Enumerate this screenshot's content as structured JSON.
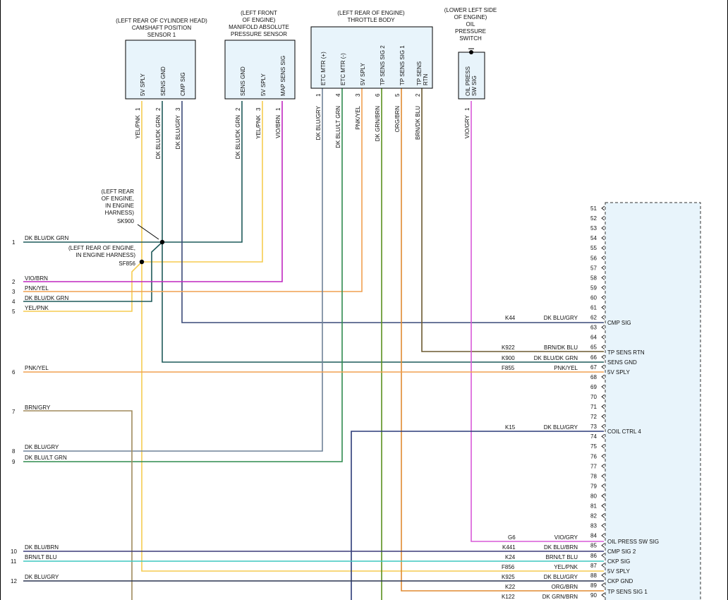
{
  "components": {
    "cmp_sensor": {
      "heading": [
        "(LEFT REAR OF CYLINDER HEAD)",
        "CAMSHAFT POSITION",
        "SENSOR 1"
      ],
      "pins": [
        {
          "num": "1",
          "name": "5V SPLY",
          "wire": "YEL/PNK"
        },
        {
          "num": "2",
          "name": "SENS GND",
          "wire": "DK BLU/DK GRN"
        },
        {
          "num": "3",
          "name": "CMP SIG",
          "wire": "DK BLU/GRY"
        }
      ]
    },
    "map_sensor": {
      "heading": [
        "(LEFT FRONT",
        "OF ENGINE)",
        "MANIFOLD ABSOLUTE",
        "PRESSURE SENSOR"
      ],
      "pins": [
        {
          "num": "2",
          "name": "SENS GND",
          "wire": "DK BLU/DK GRN"
        },
        {
          "num": "3",
          "name": "5V SPLY",
          "wire": "YEL/PNK"
        },
        {
          "num": "1",
          "name": "MAP SENS SIG",
          "wire": "VIO/BRN"
        }
      ]
    },
    "throttle_body": {
      "heading": [
        "(LEFT REAR OF ENGINE)",
        "THROTTLE BODY"
      ],
      "pins": [
        {
          "num": "1",
          "name": "ETC MTR (+)",
          "wire": "DK BLU/GRY"
        },
        {
          "num": "4",
          "name": "ETC MTR (-)",
          "wire": "DK BLU/LT GRN"
        },
        {
          "num": "3",
          "name": "5V SPLY",
          "wire": "PNK/YEL"
        },
        {
          "num": "6",
          "name": "TP SENS SIG 2",
          "wire": "DK GRN/BRN"
        },
        {
          "num": "5",
          "name": "TP SENS SIG 1",
          "wire": "ORG/BRN"
        },
        {
          "num": "2",
          "name": "TP SENS RTN",
          "wire": "BRN/DK BLU"
        }
      ]
    },
    "oil_switch": {
      "heading": [
        "(LOWER LEFT SIDE",
        "OF ENGINE)",
        "OIL",
        "PRESSURE",
        "SWITCH"
      ],
      "pins": [
        {
          "num": "1",
          "name": "OIL PRESS SW SIG",
          "wire": "VIO/GRY"
        }
      ]
    }
  },
  "splices": {
    "sk900": [
      "(LEFT REAR",
      "OF ENGINE,",
      "IN ENGINE",
      "HARNESS)",
      "SK900"
    ],
    "sf856": [
      "(LEFT REAR OF ENGINE,",
      "IN ENGINE HARNESS)",
      "SF856"
    ]
  },
  "left_wires": [
    {
      "num": "1",
      "label": "DK BLU/DK GRN",
      "color": "#1f5a5a"
    },
    {
      "num": "2",
      "label": "VIO/BRN",
      "color": "#c026c0"
    },
    {
      "num": "3",
      "label": "PNK/YEL",
      "color": "#f0a050"
    },
    {
      "num": "4",
      "label": "DK BLU/DK GRN",
      "color": "#1f5a5a"
    },
    {
      "num": "5",
      "label": "YEL/PNK",
      "color": "#f5cc50"
    },
    {
      "num": "6",
      "label": "PNK/YEL",
      "color": "#f0a050"
    },
    {
      "num": "7",
      "label": "BRN/GRY",
      "color": "#a08a5c"
    },
    {
      "num": "8",
      "label": "DK BLU/GRY",
      "color": "#6f8298"
    },
    {
      "num": "9",
      "label": "DK BLU/LT GRN",
      "color": "#2f8b4f"
    },
    {
      "num": "10",
      "label": "DK BLU/BRN",
      "color": "#3a3a78"
    },
    {
      "num": "11",
      "label": "BRN/LT BLU",
      "color": "#3ec7c0"
    },
    {
      "num": "12",
      "label": "DK BLU/GRY",
      "color": "#2a3550"
    }
  ],
  "pcm_connector": {
    "pin_numbers": [
      "51",
      "52",
      "53",
      "54",
      "55",
      "56",
      "57",
      "58",
      "59",
      "60",
      "61",
      "62",
      "63",
      "64",
      "65",
      "66",
      "67",
      "68",
      "69",
      "70",
      "71",
      "72",
      "73",
      "74",
      "75",
      "76",
      "77",
      "78",
      "79",
      "80",
      "81",
      "82",
      "83",
      "84",
      "85",
      "86",
      "87",
      "88",
      "89",
      "90"
    ],
    "circuits": [
      {
        "pin": "62",
        "circuit": "K44",
        "wire": "DK BLU/GRY",
        "function": "CMP SIG"
      },
      {
        "pin": "65",
        "circuit": "K922",
        "wire": "BRN/DK BLU",
        "function": "TP SENS RTN"
      },
      {
        "pin": "66",
        "circuit": "K900",
        "wire": "DK BLU/DK GRN",
        "function": "SENS GND"
      },
      {
        "pin": "67",
        "circuit": "F855",
        "wire": "PNK/YEL",
        "function": "5V SPLY"
      },
      {
        "pin": "73",
        "circuit": "K15",
        "wire": "DK BLU/GRY",
        "function": "COIL CTRL 4"
      },
      {
        "pin": "84",
        "circuit": "G6",
        "wire": "VIO/GRY",
        "function": "OIL PRESS SW SIG"
      },
      {
        "pin": "85",
        "circuit": "K441",
        "wire": "DK BLU/BRN",
        "function": "CMP SIG 2"
      },
      {
        "pin": "86",
        "circuit": "K24",
        "wire": "BRN/LT BLU",
        "function": "CKP SIG"
      },
      {
        "pin": "87",
        "circuit": "F856",
        "wire": "YEL/PNK",
        "function": "5V SPLY"
      },
      {
        "pin": "88",
        "circuit": "K925",
        "wire": "DK BLU/GRY",
        "function": "CKP GND"
      },
      {
        "pin": "89",
        "circuit": "K22",
        "wire": "ORG/BRN",
        "function": "TP SENS SIG 1"
      },
      {
        "pin": "90",
        "circuit": "K122",
        "wire": "DK GRN/BRN",
        "function": ""
      }
    ]
  },
  "colors": {
    "yel_pnk": "#f5cc50",
    "dk_blu_dk_grn": "#1f5a5a",
    "dk_blu_gry": "#6f8298",
    "vio_brn": "#c026c0",
    "pnk_yel": "#f0a050",
    "dk_blu_lt_grn": "#2f8b4f",
    "dk_grn_brn": "#5a8f1e",
    "org_brn": "#e08a30",
    "brn_dk_blu": "#6b5a30",
    "vio_gry": "#d85ad8",
    "brn_gry": "#a08a5c",
    "dk_blu_brn": "#3a3a78",
    "brn_lt_blu": "#3ec7c0",
    "dk_blu_gry_dark": "#2a3550",
    "dk_blu_coil": "#2b3a78",
    "box_fill": "#e8f4fb"
  }
}
